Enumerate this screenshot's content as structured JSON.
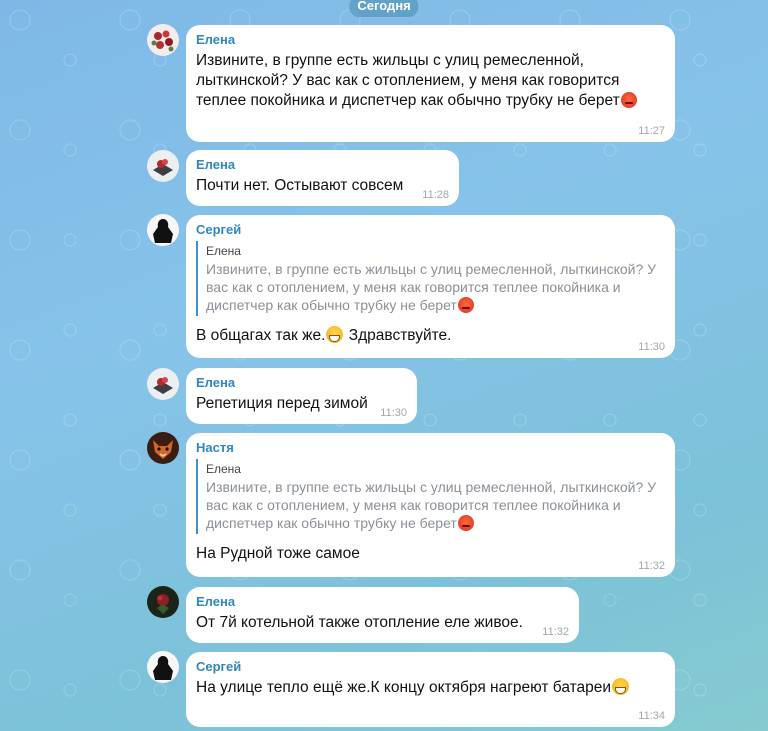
{
  "date_divider": "Сегодня",
  "messages": [
    {
      "sender": "Елена",
      "text": "Извините, в группе есть жильцы с улиц ремесленной, лыткинской? У вас как с отоплением, у меня как говорится теплее покойника и диспетчер как обычно трубку не берет",
      "emoji": "angry-face",
      "time": "11:27",
      "avatar": "avatar-elena-flowers"
    },
    {
      "sender": "Елена",
      "text": "Почти нет. Остывают совсем",
      "time": "11:28",
      "avatar": "avatar-elena-rose"
    },
    {
      "sender": "Сергей",
      "reply": {
        "name": "Елена",
        "text": "Извините, в группе есть жильцы с улиц ремесленной, лыткинской? У вас как с отоплением, у меня как говорится теплее покойника и диспетчер как обычно трубку не берет"
      },
      "text": "В общагах так же.",
      "text_after_emoji": " Здравствуйте.",
      "emoji": "grinning-face",
      "time": "11:30",
      "avatar": "avatar-sergey-silhouette"
    },
    {
      "sender": "Елена",
      "text": "Репетиция перед зимой",
      "time": "11:30",
      "avatar": "avatar-elena-rose"
    },
    {
      "sender": "Настя",
      "reply": {
        "name": "Елена",
        "text": "Извините, в группе есть жильцы с улиц ремесленной, лыткинской? У вас как с отоплением, у меня как говорится теплее покойника и диспетчер как обычно трубку не берет"
      },
      "text": "На Рудной тоже самое",
      "time": "11:32",
      "avatar": "avatar-nastya-fox"
    },
    {
      "sender": "Елена",
      "text": "От 7й котельной также отопление еле живое.",
      "time": "11:32",
      "avatar": "avatar-elena-dark"
    },
    {
      "sender": "Сергей",
      "text": "На улице тепло ещё же.К концу октября нагреют батареи",
      "emoji": "grinning-face",
      "time": "11:34",
      "avatar": "avatar-sergey-silhouette"
    }
  ],
  "colors": {
    "sender_name": "#2f87c1",
    "bubble": "#ffffff",
    "timestamp": "#a0a7ad",
    "reply_bar": "#3a92cf"
  }
}
